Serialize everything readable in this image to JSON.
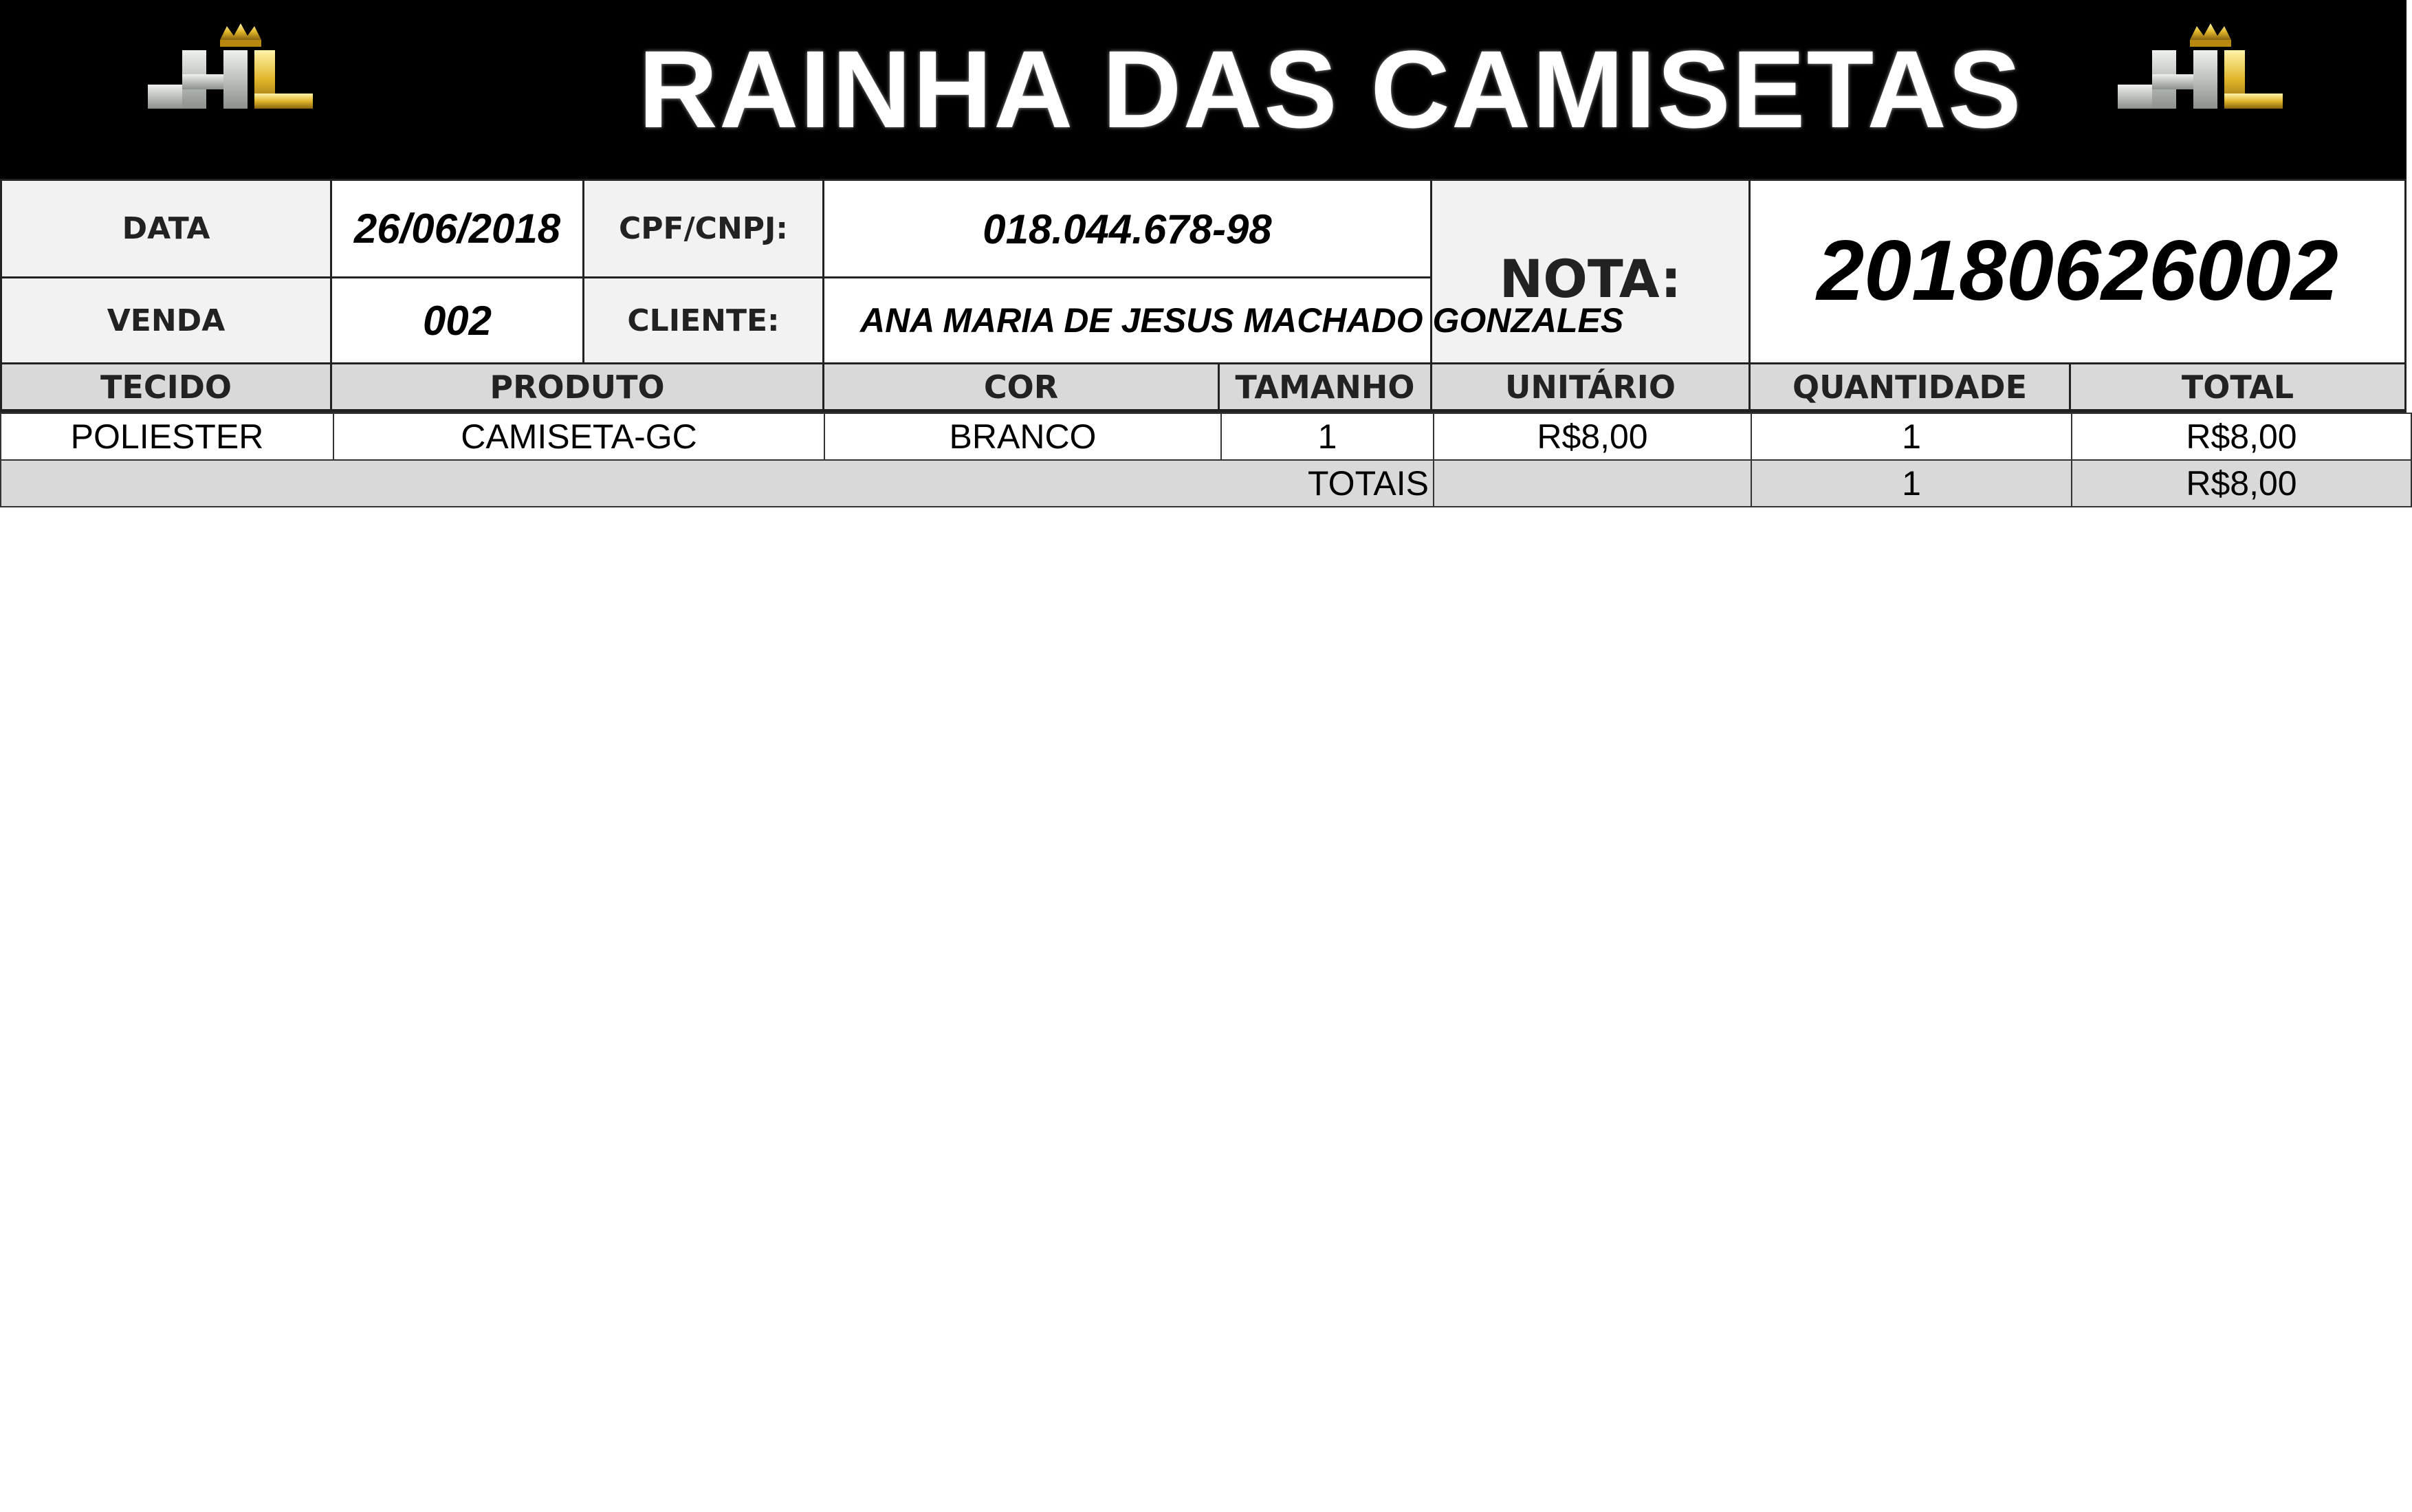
{
  "header": {
    "title": "RAINHA DAS CAMISETAS",
    "logo_text": "HL",
    "colors": {
      "banner": "#000000",
      "logo_gold": "#d4a017",
      "logo_silver": "#c9ccc9"
    }
  },
  "info": {
    "data_label": "DATA",
    "data_value": "26/06/2018",
    "cpf_label": "CPF/CNPJ:",
    "cpf_value": "018.044.678-98",
    "venda_label": "VENDA",
    "venda_value": "002",
    "cliente_label": "CLIENTE:",
    "cliente_value": "ANA MARIA DE JESUS MACHADO GONZALES",
    "nota_label": "NOTA:",
    "nota_value": "20180626002"
  },
  "table": {
    "headers": [
      "TECIDO",
      "PRODUTO",
      "COR",
      "TAMANHO",
      "UNITÁRIO",
      "QUANTIDADE",
      "TOTAL"
    ],
    "rows": [
      [
        "POLIESTER",
        "CAMISETA-GC",
        "BRANCO",
        "1",
        "R$8,00",
        "1",
        "R$8,00"
      ]
    ],
    "totals": {
      "label": "TOTAIS",
      "quantidade": "1",
      "total": "R$8,00"
    }
  }
}
